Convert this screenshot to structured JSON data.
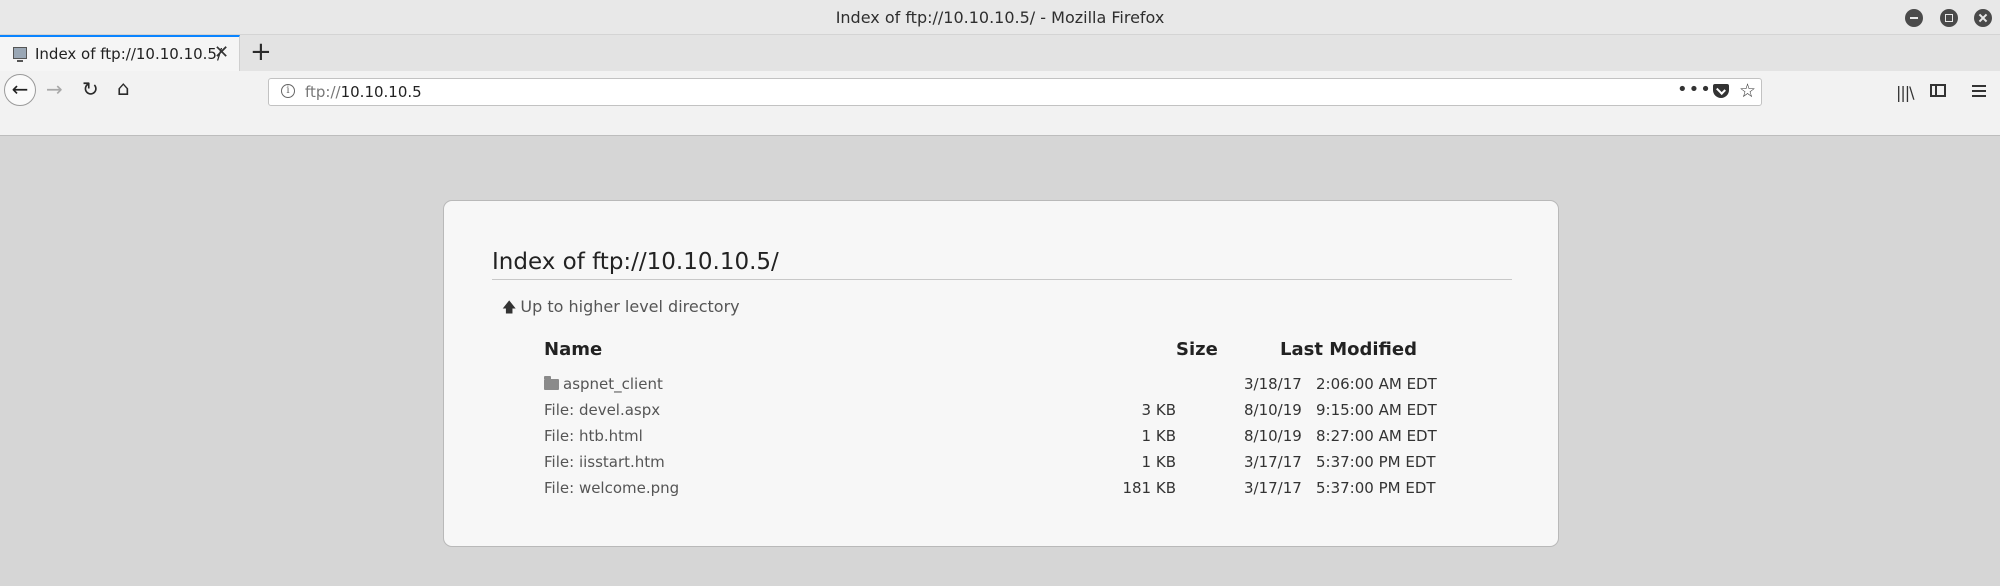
{
  "window": {
    "title": "Index of ftp://10.10.10.5/ - Mozilla Firefox"
  },
  "tab": {
    "title": "Index of ftp://10.10.10.5/",
    "close_label": "✕",
    "new_tab_label": "+"
  },
  "navbar": {
    "back_label": "←",
    "forward_label": "→",
    "reload_label": "↻",
    "home_label": "⌂",
    "url_scheme": "ftp://",
    "url_host": "10.10.10.5",
    "page_actions_label": "•••",
    "bookmark_label": "☆",
    "library_label": "|||\\"
  },
  "page": {
    "heading": "Index of ftp://10.10.10.5/",
    "up_link": "Up to higher level directory",
    "columns": {
      "name": "Name",
      "size": "Size",
      "last_modified": "Last Modified"
    },
    "rows": [
      {
        "type": "folder",
        "prefix": "",
        "name": "aspnet_client",
        "size": "",
        "date": "3/18/17",
        "time": "2:06:00 AM EDT"
      },
      {
        "type": "file",
        "prefix": "File:",
        "name": "devel.aspx",
        "size": "3 KB",
        "date": "8/10/19",
        "time": "9:15:00 AM EDT"
      },
      {
        "type": "file",
        "prefix": "File:",
        "name": "htb.html",
        "size": "1 KB",
        "date": "8/10/19",
        "time": "8:27:00 AM EDT"
      },
      {
        "type": "file",
        "prefix": "File:",
        "name": "iisstart.htm",
        "size": "1 KB",
        "date": "3/17/17",
        "time": "5:37:00 PM EDT"
      },
      {
        "type": "file",
        "prefix": "File:",
        "name": "welcome.png",
        "size": "181 KB",
        "date": "3/17/17",
        "time": "5:37:00 PM EDT"
      }
    ]
  }
}
